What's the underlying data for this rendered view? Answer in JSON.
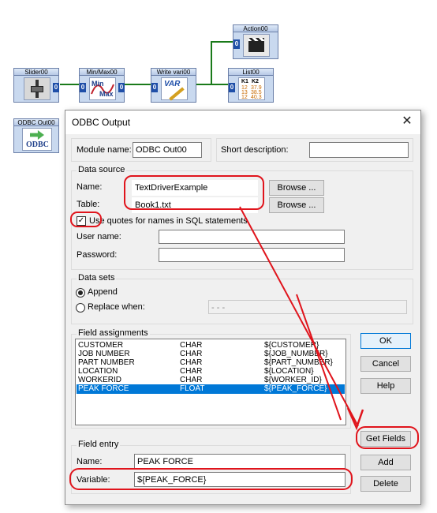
{
  "canvas": {
    "modules": [
      {
        "title": "Slider00",
        "port_in": "",
        "port_out": "0"
      },
      {
        "title": "Min/Max00",
        "port_in": "0",
        "port_out": "0",
        "icon_top": "Min",
        "icon_bottom": "Max"
      },
      {
        "title": "Write vari00",
        "port_in": "0",
        "port_out": "",
        "icon_text": "VAR"
      },
      {
        "title": "Action00",
        "port_in": "0"
      },
      {
        "title": "List00",
        "port_in": "0",
        "k1": "K1",
        "k2": "K2",
        "col1": [
          "12",
          "13",
          "12"
        ],
        "col2": [
          "37.9",
          "38.5",
          "40.3"
        ]
      },
      {
        "title": "ODBC Out00",
        "icon_text": "ODBC"
      }
    ]
  },
  "dialog": {
    "title": "ODBC Output",
    "module_name_label": "Module name:",
    "module_name_value": "ODBC Out00",
    "short_desc_label": "Short description:",
    "short_desc_value": "",
    "data_source": {
      "title": "Data source",
      "name_label": "Name:",
      "name_value": "TextDriverExample",
      "table_label": "Table:",
      "table_value": "Book1.txt",
      "browse_label": "Browse ...",
      "use_quotes_label": "Use quotes for names in SQL statements",
      "use_quotes_checked": true,
      "user_label": "User name:",
      "user_value": "",
      "password_label": "Password:",
      "password_value": ""
    },
    "data_sets": {
      "title": "Data sets",
      "append_label": "Append",
      "replace_label": "Replace when:",
      "replace_value": "- - -",
      "selected": "append"
    },
    "field_assignments": {
      "title": "Field assignments",
      "rows": [
        {
          "name": "CUSTOMER",
          "type": "CHAR",
          "var": "${CUSTOMER}"
        },
        {
          "name": "JOB NUMBER",
          "type": "CHAR",
          "var": "${JOB_NUMBER}"
        },
        {
          "name": "PART NUMBER",
          "type": "CHAR",
          "var": "${PART_NUMBER}"
        },
        {
          "name": "LOCATION",
          "type": "CHAR",
          "var": "${LOCATION}"
        },
        {
          "name": "WORKERID",
          "type": "CHAR",
          "var": "${WORKER_ID}"
        },
        {
          "name": "PEAK FORCE",
          "type": "FLOAT",
          "var": "${PEAK_FORCE}"
        }
      ],
      "selected_index": 5
    },
    "field_entry": {
      "title": "Field entry",
      "name_label": "Name:",
      "name_value": "PEAK FORCE",
      "variable_label": "Variable:",
      "variable_value": "${PEAK_FORCE}"
    },
    "buttons": {
      "ok": "OK",
      "cancel": "Cancel",
      "help": "Help",
      "get_fields": "Get Fields",
      "add": "Add",
      "delete": "Delete"
    }
  },
  "colors": {
    "highlight": "#e0141c",
    "selection": "#0078d7",
    "wire": "#1a7a1a"
  }
}
